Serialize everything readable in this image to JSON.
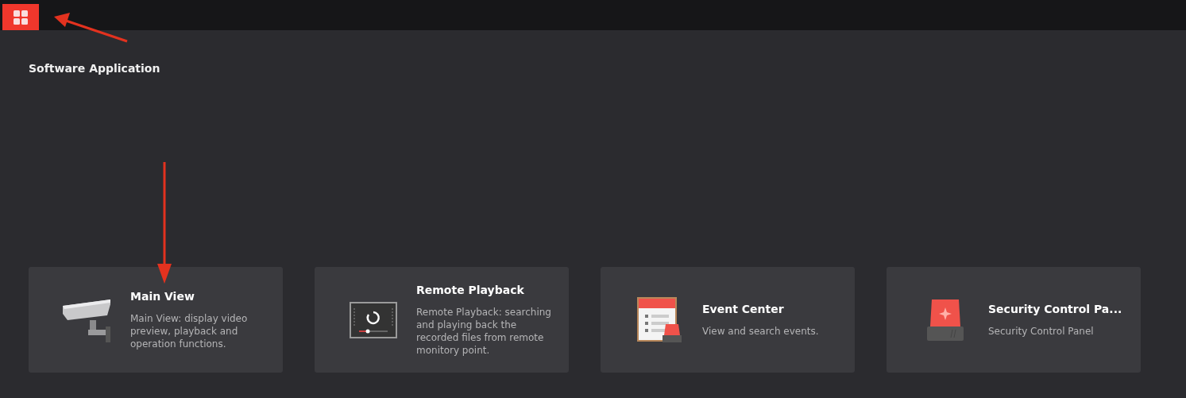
{
  "header": {
    "title": "Software Application"
  },
  "modules": [
    {
      "kind": "camera",
      "title": "Main View",
      "description": "Main View: display video preview, playback and operation functions."
    },
    {
      "kind": "playback",
      "title": "Remote Playback",
      "description": "Remote Playback: searching and playing back the recorded files from remote monitory point."
    },
    {
      "kind": "event",
      "title": "Event Center",
      "description": "View and search events."
    },
    {
      "kind": "alarm",
      "title": "Security Control Pa...",
      "description": "Security Control Panel"
    }
  ]
}
